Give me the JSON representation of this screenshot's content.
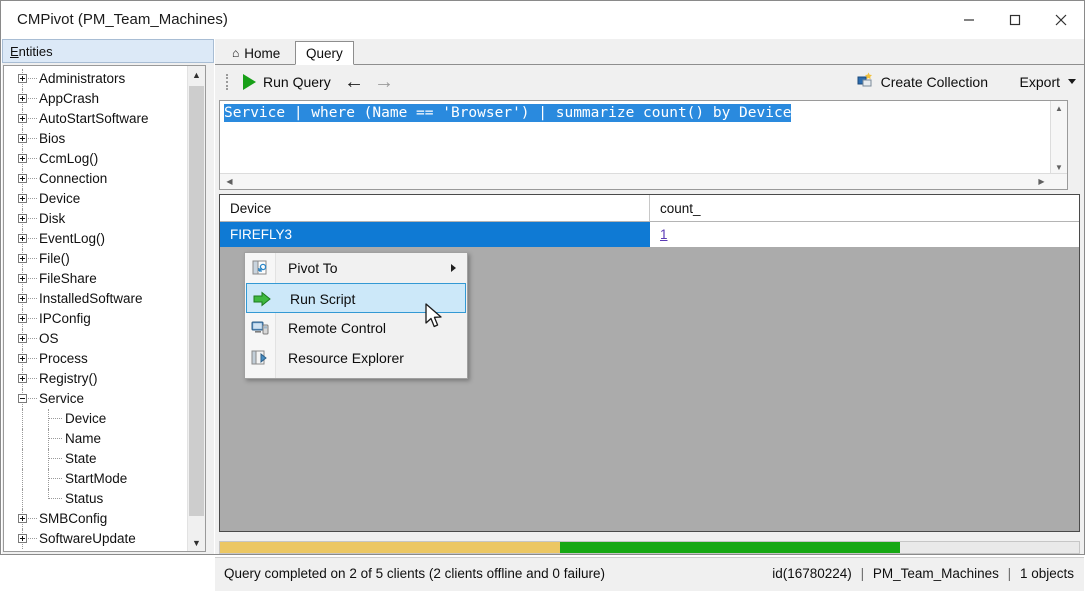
{
  "window": {
    "title": "CMPivot (PM_Team_Machines)",
    "controls": [
      {
        "name": "minimize-button",
        "glyph": "minimize"
      },
      {
        "name": "maximize-button",
        "glyph": "maximize"
      },
      {
        "name": "close-button",
        "glyph": "close"
      }
    ]
  },
  "sidebar": {
    "header": "Entities",
    "header_accel": "E",
    "header_rest": "ntities",
    "items": [
      {
        "label": "Administrators",
        "expandable": true,
        "expanded": false,
        "child": false
      },
      {
        "label": "AppCrash",
        "expandable": true,
        "expanded": false,
        "child": false
      },
      {
        "label": "AutoStartSoftware",
        "expandable": true,
        "expanded": false,
        "child": false
      },
      {
        "label": "Bios",
        "expandable": true,
        "expanded": false,
        "child": false
      },
      {
        "label": "CcmLog()",
        "expandable": true,
        "expanded": false,
        "child": false
      },
      {
        "label": "Connection",
        "expandable": true,
        "expanded": false,
        "child": false
      },
      {
        "label": "Device",
        "expandable": true,
        "expanded": false,
        "child": false
      },
      {
        "label": "Disk",
        "expandable": true,
        "expanded": false,
        "child": false
      },
      {
        "label": "EventLog()",
        "expandable": true,
        "expanded": false,
        "child": false
      },
      {
        "label": "File()",
        "expandable": true,
        "expanded": false,
        "child": false
      },
      {
        "label": "FileShare",
        "expandable": true,
        "expanded": false,
        "child": false
      },
      {
        "label": "InstalledSoftware",
        "expandable": true,
        "expanded": false,
        "child": false
      },
      {
        "label": "IPConfig",
        "expandable": true,
        "expanded": false,
        "child": false
      },
      {
        "label": "OS",
        "expandable": true,
        "expanded": false,
        "child": false
      },
      {
        "label": "Process",
        "expandable": true,
        "expanded": false,
        "child": false
      },
      {
        "label": "Registry()",
        "expandable": true,
        "expanded": false,
        "child": false
      },
      {
        "label": "Service",
        "expandable": true,
        "expanded": true,
        "child": false
      },
      {
        "label": "Device",
        "expandable": false,
        "expanded": false,
        "child": true
      },
      {
        "label": "Name",
        "expandable": false,
        "expanded": false,
        "child": true
      },
      {
        "label": "State",
        "expandable": false,
        "expanded": false,
        "child": true
      },
      {
        "label": "StartMode",
        "expandable": false,
        "expanded": false,
        "child": true
      },
      {
        "label": "Status",
        "expandable": false,
        "expanded": false,
        "child": true,
        "last": true
      },
      {
        "label": "SMBConfig",
        "expandable": true,
        "expanded": false,
        "child": false
      },
      {
        "label": "SoftwareUpdate",
        "expandable": true,
        "expanded": false,
        "child": false
      }
    ]
  },
  "tabs": [
    {
      "label": "Home",
      "icon": "home-icon",
      "active": false
    },
    {
      "label": "Query",
      "icon": "",
      "active": true
    }
  ],
  "toolbar": {
    "run_query_label": "Run Query",
    "back_label": "←",
    "forward_label": "→",
    "create_collection_label": "Create Collection",
    "export_label": "Export"
  },
  "editor": {
    "query_text": "Service | where (Name == 'Browser') | summarize count() by Device",
    "selected": true
  },
  "results": {
    "columns": [
      "Device",
      "count_"
    ],
    "rows": [
      {
        "device": "FIREFLY3",
        "count": "1"
      }
    ]
  },
  "context_menu": {
    "items": [
      {
        "label": "Pivot To",
        "icon": "pivot-icon",
        "has_submenu": true,
        "highlighted": false
      },
      {
        "label": "Run Script",
        "icon": "run-script-icon",
        "has_submenu": false,
        "highlighted": true
      },
      {
        "label": "Remote Control",
        "icon": "remote-control-icon",
        "has_submenu": false,
        "highlighted": false
      },
      {
        "label": "Resource Explorer",
        "icon": "resource-explorer-icon",
        "has_submenu": false,
        "highlighted": false
      }
    ]
  },
  "status": {
    "message": "Query completed on 2 of 5 clients (2 clients offline and 0 failure)",
    "id": "id(16780224)",
    "collection": "PM_Team_Machines",
    "objects": "1 objects",
    "separator": "|"
  },
  "colors": {
    "selection_blue": "#0f7ad4",
    "code_selection": "#2a8ade",
    "progress_yellow": "#ecc763",
    "progress_green": "#16a814",
    "grid_background": "#ababab",
    "link_purple": "#5b3bb5",
    "menu_highlight": "#cce8f9"
  }
}
